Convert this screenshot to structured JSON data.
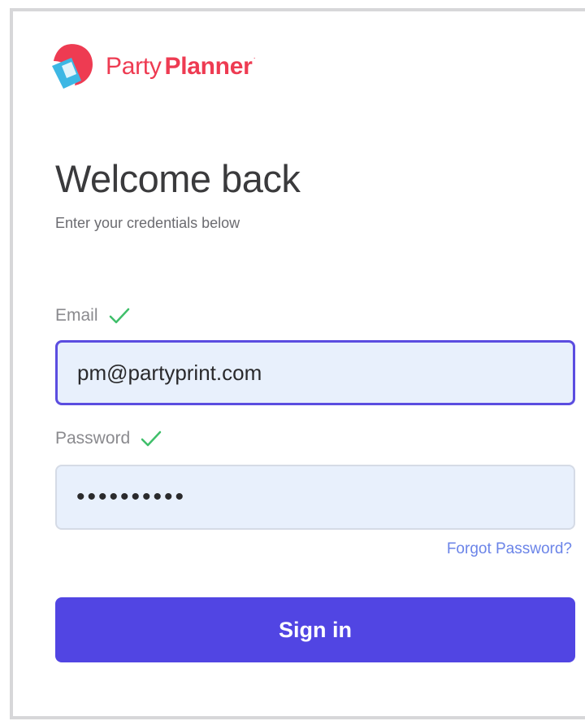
{
  "brand": {
    "name_part1": "Party",
    "name_part2": "Planner",
    "trademark": "·",
    "logo_icon": "party-planner-logo-icon",
    "color": "#ee3b52"
  },
  "heading": {
    "title": "Welcome back",
    "subtitle": "Enter your credentials below"
  },
  "form": {
    "email": {
      "label": "Email",
      "value": "pm@partyprint.com",
      "valid": true,
      "valid_icon": "check-icon"
    },
    "password": {
      "label": "Password",
      "value": "••••••••••",
      "valid": true,
      "valid_icon": "check-icon"
    },
    "forgot_password_label": "Forgot Password?",
    "submit_label": "Sign in"
  },
  "colors": {
    "accent": "#5145e3",
    "input_background": "#e8f0fc",
    "focus_border": "#5b4de0",
    "valid_check": "#3fbf6a",
    "link": "#6b84e8"
  }
}
